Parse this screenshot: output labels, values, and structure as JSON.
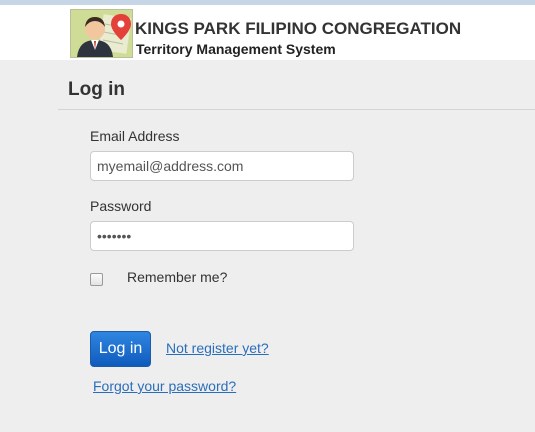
{
  "header": {
    "title": "KINGS PARK FILIPINO CONGREGATION",
    "subtitle": "Territory Management System",
    "logo_icon": "person-map-pin-icon"
  },
  "login": {
    "heading": "Log in",
    "email_label": "Email Address",
    "email_value": "myemail@address.com",
    "password_label": "Password",
    "password_value": "•••••••",
    "remember_label": "Remember me?",
    "remember_checked": false,
    "submit_label": "Log in",
    "register_link": "Not register yet?",
    "forgot_link": "Forgot your password?"
  },
  "colors": {
    "accent": "#0f5bbd",
    "link": "#2a6ebb",
    "background": "#eeeeee"
  }
}
